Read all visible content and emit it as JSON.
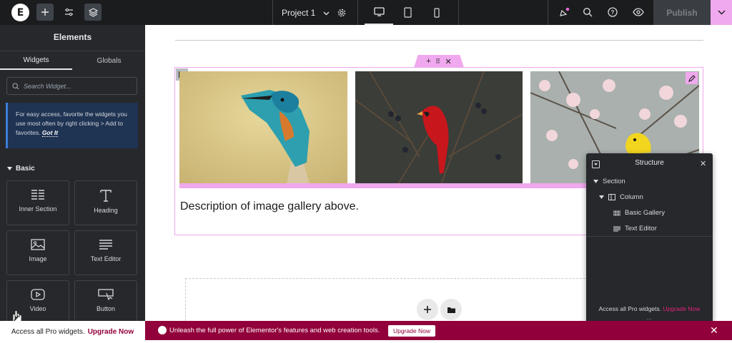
{
  "topbar": {
    "logo": "E",
    "project_name": "Project 1",
    "publish_label": "Publish",
    "icons": [
      "elementor-logo-icon",
      "plus-icon",
      "sliders-icon",
      "layers-icon",
      "chevron-down-icon",
      "gear-icon",
      "desktop-icon",
      "tablet-icon",
      "mobile-icon",
      "notification-icon",
      "search-icon",
      "help-icon",
      "eye-icon",
      "chevron-down-icon"
    ],
    "publish_arrow_color": "#f0a8ee"
  },
  "panel": {
    "title": "Elements",
    "tabs": [
      {
        "label": "Widgets"
      },
      {
        "label": "Globals"
      }
    ],
    "search_placeholder": "Search Widget...",
    "tip_text": "For easy access, favorite the widgets you use most often by right clicking > Add to favorites.",
    "tip_link": "Got It",
    "category": "Basic",
    "widgets": [
      {
        "label": "Inner Section"
      },
      {
        "label": "Heading"
      },
      {
        "label": "Image"
      },
      {
        "label": "Text Editor"
      },
      {
        "label": "Video"
      },
      {
        "label": "Button"
      }
    ]
  },
  "canvas": {
    "description": "Description of image gallery above.",
    "gallery_images": [
      "kingfisher",
      "cardinal",
      "yellow-bird-blossoms"
    ],
    "accent_color": "#f0a8ee"
  },
  "structure": {
    "title": "Structure",
    "items": [
      {
        "label": "Section"
      },
      {
        "label": "Column"
      },
      {
        "label": "Basic Gallery"
      },
      {
        "label": "Text Editor"
      }
    ],
    "promo_text": "Access all Pro widgets.",
    "promo_link": "Upgrade Now"
  },
  "bottom": {
    "left_text": "Access all Pro widgets.",
    "left_link": "Upgrade Now",
    "banner_text": "Unleash the full power of Elementor's features and web creation tools.",
    "banner_button": "Upgrade Now",
    "banner_color": "#92003b"
  }
}
